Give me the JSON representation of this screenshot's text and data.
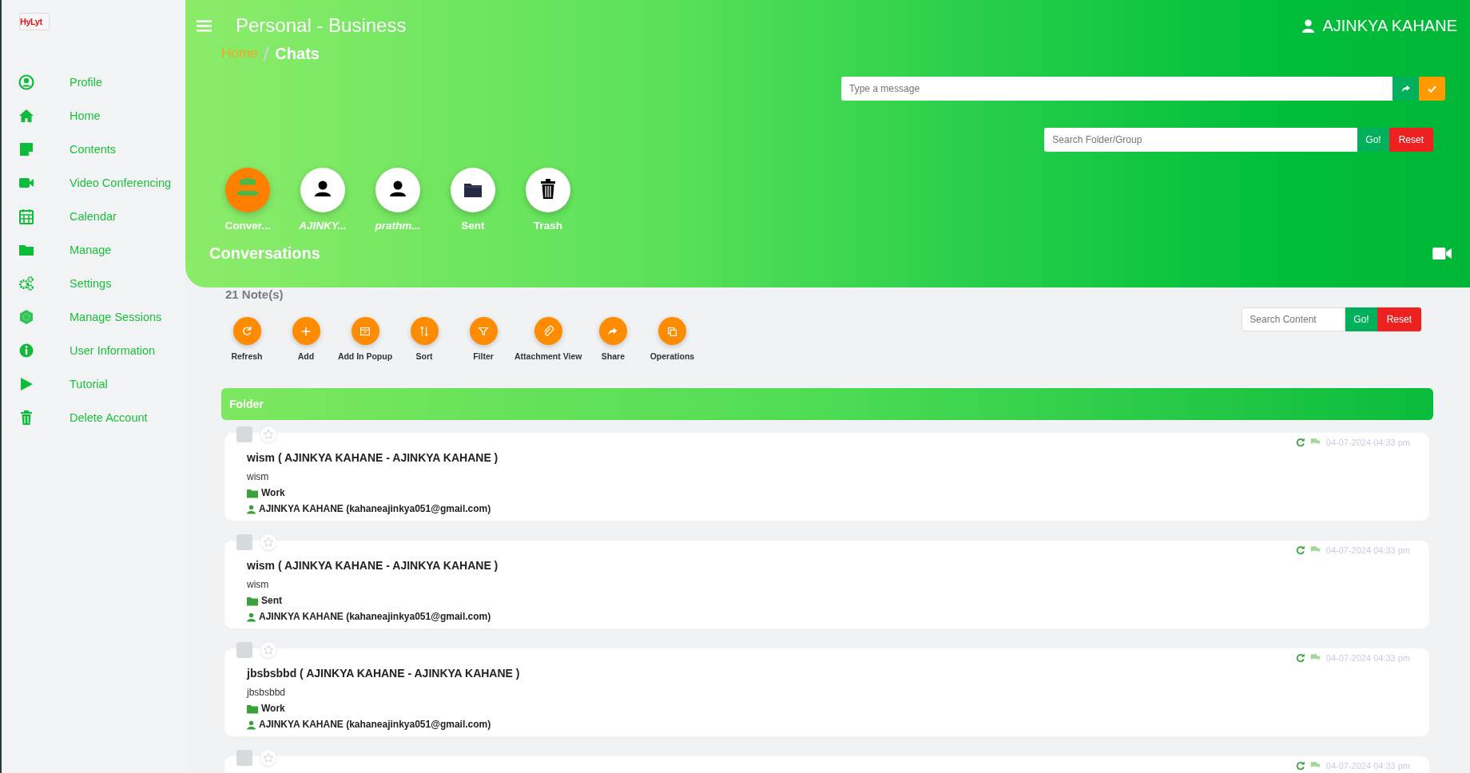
{
  "logo": "HyLyt",
  "sidebar": {
    "items": [
      {
        "label": "Profile",
        "kind": "profile"
      },
      {
        "label": "Home",
        "kind": "home"
      },
      {
        "label": "Contents",
        "kind": "note"
      },
      {
        "label": "Video Conferencing",
        "kind": "video"
      },
      {
        "label": "Calendar",
        "kind": "calendar"
      },
      {
        "label": "Manage",
        "kind": "folder"
      },
      {
        "label": "Settings",
        "kind": "gears"
      },
      {
        "label": "Manage Sessions",
        "kind": "hexagon"
      },
      {
        "label": "User Information",
        "kind": "info"
      },
      {
        "label": "Tutorial",
        "kind": "play"
      },
      {
        "label": "Delete Account",
        "kind": "trash"
      }
    ]
  },
  "header": {
    "title": "Personal - Business",
    "user": "AJINKYA KAHANE",
    "breadcrumb": [
      {
        "label": "Home",
        "kind": "link"
      },
      {
        "label": "Chats",
        "kind": "current"
      }
    ],
    "message": {
      "placeholder": "Type a message"
    },
    "folder_search": {
      "placeholder": "Search Folder/Group",
      "go": "Go!",
      "reset": "Reset"
    },
    "tabs": [
      {
        "label": "Conver...",
        "kind": "group",
        "selected": true
      },
      {
        "label": "AJINKY...",
        "kind": "user",
        "selected": false
      },
      {
        "label": "prathm...",
        "kind": "user",
        "selected": false
      },
      {
        "label": "Sent",
        "kind": "folder",
        "selected": false
      },
      {
        "label": "Trash",
        "kind": "trash",
        "selected": false
      }
    ],
    "section": "Conversations"
  },
  "notes_count": "21 Note(s)",
  "toolbar": [
    {
      "label": "Refresh",
      "kind": "refresh"
    },
    {
      "label": "Add",
      "kind": "plus"
    },
    {
      "label": "Add In Popup",
      "kind": "popup"
    },
    {
      "label": "Sort",
      "kind": "sort"
    },
    {
      "label": "Filter",
      "kind": "filter"
    },
    {
      "label": "Attachment View",
      "kind": "clip"
    },
    {
      "label": "Share",
      "kind": "share"
    },
    {
      "label": "Operations",
      "kind": "copy"
    }
  ],
  "content_search": {
    "placeholder": "Search Content",
    "go": "Go!",
    "reset": "Reset"
  },
  "folder_bar": "Folder",
  "notes": [
    {
      "checked": false,
      "starred": false,
      "date": "04-07-2024 04:33 pm",
      "title": "wism ( AJINKYA KAHANE - AJINKYA KAHANE )",
      "body": "wism",
      "folder": "Work",
      "owner": "AJINKYA KAHANE (kahaneajinkya051@gmail.com)"
    },
    {
      "checked": false,
      "starred": false,
      "date": "04-07-2024 04:33 pm",
      "title": "wism ( AJINKYA KAHANE - AJINKYA KAHANE )",
      "body": "wism",
      "folder": "Sent",
      "owner": "AJINKYA KAHANE (kahaneajinkya051@gmail.com)"
    },
    {
      "checked": false,
      "starred": false,
      "date": "04-07-2024 04:33 pm",
      "title": "jbsbsbbd ( AJINKYA KAHANE - AJINKYA KAHANE )",
      "body": "jbsbsbbd",
      "folder": "Work",
      "owner": "AJINKYA KAHANE (kahaneajinkya051@gmail.com)"
    },
    {
      "checked": false,
      "starred": false,
      "date": "04-07-2024 04:33 pm"
    }
  ]
}
